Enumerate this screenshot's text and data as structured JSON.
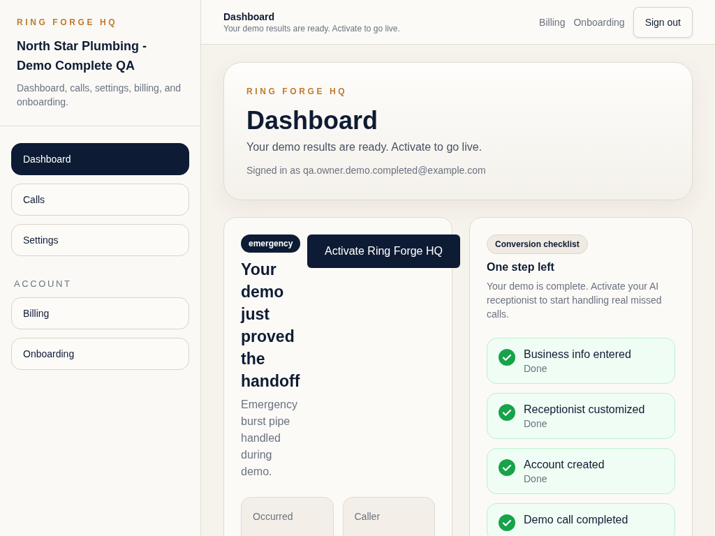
{
  "sidebar": {
    "brand": "RING FORGE HQ",
    "business": "North Star Plumbing - Demo Complete QA",
    "description": "Dashboard, calls, settings, billing, and onboarding.",
    "items": [
      {
        "label": "Dashboard",
        "selected": true
      },
      {
        "label": "Calls",
        "selected": false
      },
      {
        "label": "Settings",
        "selected": false
      }
    ],
    "section_label": "ACCOUNT",
    "account_items": [
      {
        "label": "Billing",
        "selected": false
      },
      {
        "label": "Onboarding",
        "selected": false
      }
    ]
  },
  "header": {
    "title": "Dashboard",
    "subtitle": "Your demo results are ready. Activate to go live.",
    "links": [
      "Billing",
      "Onboarding"
    ],
    "button": "Sign out"
  },
  "hero": {
    "eyebrow": "RING FORGE HQ",
    "title": "Dashboard",
    "subtitle": "Your demo results are ready. Activate to go live.",
    "signed_in": "Signed in as qa.owner.demo.completed@example.com"
  },
  "demo_card": {
    "badge": "emergency",
    "title": "Your demo just proved the handoff",
    "description": "Emergency burst pipe handled during demo.",
    "button": "Activate Ring Forge HQ",
    "stats": [
      {
        "label": "Occurred"
      },
      {
        "label": "Caller"
      }
    ]
  },
  "checklist": {
    "badge": "Conversion checklist",
    "title": "One step left",
    "description": "Your demo is complete. Activate your AI receptionist to start handling real missed calls.",
    "items": [
      {
        "title": "Business info entered",
        "status": "Done",
        "done": true
      },
      {
        "title": "Receptionist customized",
        "status": "Done",
        "done": true
      },
      {
        "title": "Account created",
        "status": "Done",
        "done": true
      },
      {
        "title": "Demo call completed",
        "done": true
      }
    ]
  }
}
